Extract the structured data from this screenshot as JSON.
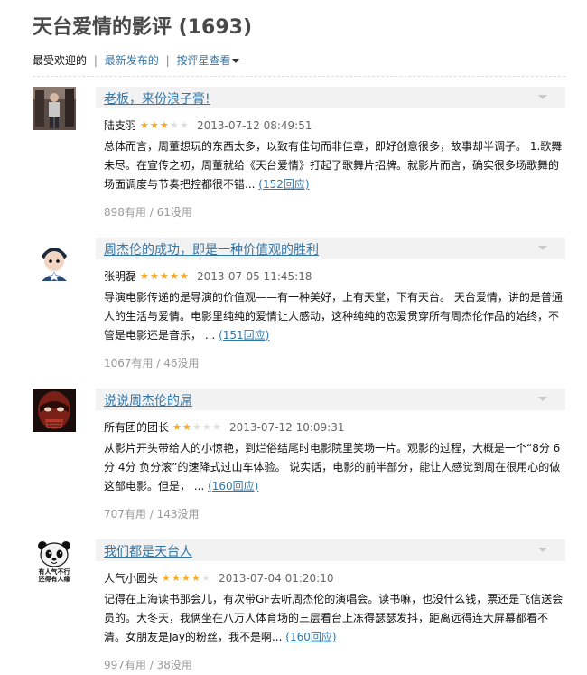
{
  "page_title": "天台爱情的影评 (1693)",
  "sort": {
    "current": "最受欢迎的",
    "separator": "|",
    "newest": "最新发布的",
    "by_rating": "按评星查看"
  },
  "reviews": [
    {
      "title": "老板，来份浪子膏!",
      "author": "陆支羽",
      "rating": 3,
      "date": "2013-07-12 08:49:51",
      "body": "总体而言，周董想玩的东西太多，以致有佳句而非佳章，即好创意很多，故事却半调子。 1.歌舞未尽。在宣传之初，周董就给《天台爱情》打起了歌舞片招牌。就影片而言，确实很多场歌舞的场面调度与节奏把控都很不错...",
      "replies": "(152回应)",
      "votes": "898有用 / 61没用",
      "avatar": "person-standing-avatar"
    },
    {
      "title": "周杰伦的成功，即是一种价值观的胜利",
      "author": "张明磊",
      "rating": 5,
      "date": "2013-07-05 11:45:18",
      "body": "导演电影传递的是导演的价值观——有一种美好，上有天堂，下有天台。 天台爱情，讲的是普通人的生活与爱情。电影里纯纯的爱情让人感动，这种纯纯的恋爱贯穿所有周杰伦作品的始终，不管是电影还是音乐， ...",
      "replies": "(151回应)",
      "votes": "1067有用 / 46没用",
      "avatar": "cartoon-boy-avatar"
    },
    {
      "title": "说说周杰伦的屌",
      "author": "所有团的团长",
      "rating": 2,
      "date": "2013-07-12 10:09:31",
      "body": "从影片开头带给人的小惊艳，到烂俗结尾时电影院里笑场一片。观影的过程，大概是一个“8分 6分 4分 负分滚”的速降式过山车体验。 说实话，电影的前半部分，能让人感觉到周在很用心的做这部电影。但是， ...",
      "replies": "(160回应)",
      "votes": "707有用 / 143没用",
      "avatar": "masked-face-avatar"
    },
    {
      "title": "我们都是天台人",
      "author": "人气小圆头",
      "rating": 4,
      "date": "2013-07-04 01:20:10",
      "body": "记得在上海读书那会儿，有次带GF去听周杰伦的演唱会。读书嘛，也没什么钱，票还是飞信送会员的。大冬天，我俩坐在八万人体育场的三层看台上冻得瑟瑟发抖，距离远得连大屏幕都看不清。女朋友是Jay的粉丝，我不是啊...",
      "replies": "(160回应)",
      "votes": "997有用 / 38没用",
      "avatar": "panda-avatar",
      "avatar_caption": "有人气不行\n还得有人缘"
    }
  ],
  "colors": {
    "link": "#3377aa",
    "star_on": "#f5a623",
    "star_off": "#dddddd",
    "title_bar_bg": "#f2f2f2",
    "muted": "#999999"
  }
}
